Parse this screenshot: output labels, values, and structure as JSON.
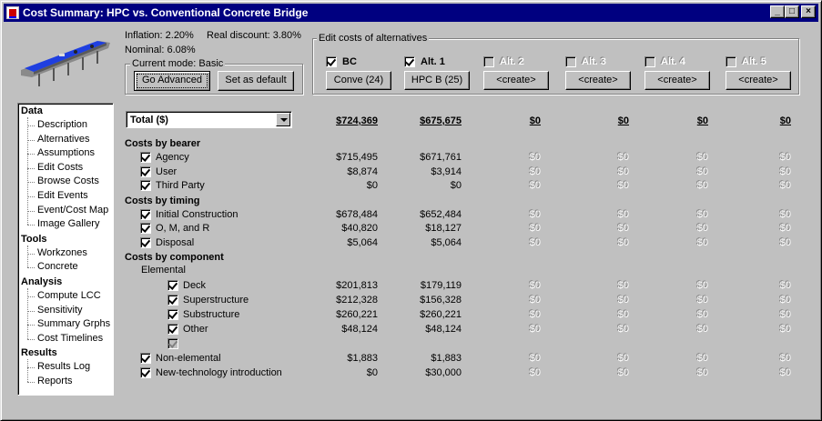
{
  "window": {
    "title": "Cost Summary: HPC vs. Conventional Concrete Bridge",
    "buttons": {
      "minimize": "_",
      "maximize": "□",
      "close": "×"
    }
  },
  "rates": {
    "inflation": "Inflation: 2.20%",
    "real_discount": "Real discount: 3.80%",
    "nominal": "Nominal: 6.08%"
  },
  "mode": {
    "group_label": "Current mode: Basic",
    "advanced_button": "Go Advanced",
    "default_button": "Set as default"
  },
  "alternatives_panel": {
    "group_label": "Edit costs of alternatives",
    "alternatives": [
      {
        "name": "BC",
        "checked": true,
        "enabled": true,
        "button": "Conve (24)"
      },
      {
        "name": "Alt. 1",
        "checked": true,
        "enabled": true,
        "button": "HPC B (25)"
      },
      {
        "name": "Alt. 2",
        "checked": false,
        "enabled": false,
        "button": "<create>"
      },
      {
        "name": "Alt. 3",
        "checked": false,
        "enabled": false,
        "button": "<create>"
      },
      {
        "name": "Alt. 4",
        "checked": false,
        "enabled": false,
        "button": "<create>"
      },
      {
        "name": "Alt. 5",
        "checked": false,
        "enabled": false,
        "button": "<create>"
      }
    ]
  },
  "nav": [
    {
      "section": "Data",
      "items": [
        "Description",
        "Alternatives",
        "Assumptions",
        "Edit Costs",
        "Browse Costs",
        "Edit Events",
        "Event/Cost Map",
        "Image Gallery"
      ]
    },
    {
      "section": "Tools",
      "items": [
        "Workzones",
        "Concrete"
      ]
    },
    {
      "section": "Analysis",
      "items": [
        "Compute LCC",
        "Sensitivity",
        "Summary Grphs",
        "Cost Timelines"
      ]
    },
    {
      "section": "Results",
      "items": [
        "Results Log",
        "Reports"
      ]
    }
  ],
  "summary": {
    "selector": "Total ($)",
    "totals": [
      "$724,369",
      "$675,675",
      "$0",
      "$0",
      "$0",
      "$0"
    ],
    "zero": "$0",
    "groups": [
      {
        "label": "Costs by bearer",
        "rows": [
          {
            "label": "Agency",
            "checked": true,
            "values": [
              "$715,495",
              "$671,761"
            ]
          },
          {
            "label": "User",
            "checked": true,
            "values": [
              "$8,874",
              "$3,914"
            ]
          },
          {
            "label": "Third Party",
            "checked": true,
            "values": [
              "$0",
              "$0"
            ]
          }
        ]
      },
      {
        "label": "Costs by timing",
        "rows": [
          {
            "label": "Initial Construction",
            "checked": true,
            "values": [
              "$678,484",
              "$652,484"
            ]
          },
          {
            "label": "O, M, and R",
            "checked": true,
            "values": [
              "$40,820",
              "$18,127"
            ]
          },
          {
            "label": "Disposal",
            "checked": true,
            "values": [
              "$5,064",
              "$5,064"
            ]
          }
        ]
      },
      {
        "label": "Costs by component",
        "subgroup": "Elemental",
        "rows": [
          {
            "label": "Deck",
            "checked": true,
            "indent": 2,
            "values": [
              "$201,813",
              "$179,119"
            ]
          },
          {
            "label": "Superstructure",
            "checked": true,
            "indent": 2,
            "values": [
              "$212,328",
              "$156,328"
            ]
          },
          {
            "label": "Substructure",
            "checked": true,
            "indent": 2,
            "values": [
              "$260,221",
              "$260,221"
            ]
          },
          {
            "label": "Other",
            "checked": true,
            "indent": 2,
            "values": [
              "$48,124",
              "$48,124"
            ]
          },
          {
            "label": "",
            "checked": true,
            "disabled": true,
            "indent": 2,
            "values": []
          },
          {
            "label": "Non-elemental",
            "checked": true,
            "indent": 1,
            "values": [
              "$1,883",
              "$1,883"
            ]
          },
          {
            "label": "New-technology introduction",
            "checked": true,
            "indent": 1,
            "values": [
              "$0",
              "$30,000"
            ]
          }
        ]
      }
    ]
  }
}
